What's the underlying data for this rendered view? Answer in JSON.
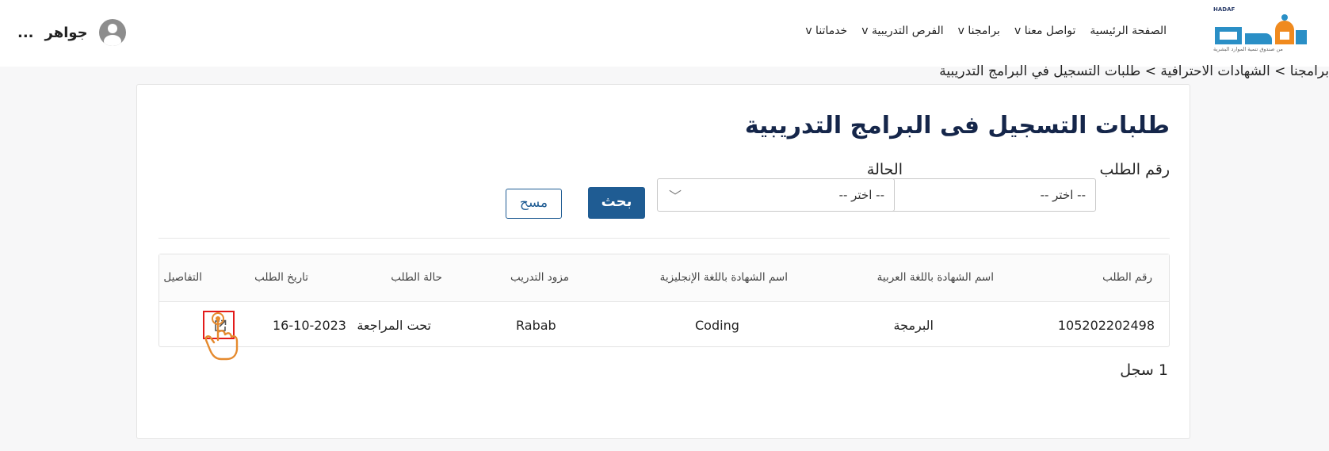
{
  "header": {
    "logo": {
      "brand_text": "HADAF",
      "tagline": "من صندوق تنمية الموارد البشرية"
    },
    "nav": [
      {
        "label": "الصفحة الرئيسية"
      },
      {
        "label": "تواصل معنا v"
      },
      {
        "label": "برامجنا v"
      },
      {
        "label": "الفرص التدريبية v"
      },
      {
        "label": "خدماتنا v"
      }
    ],
    "user": {
      "name": "جواهر",
      "more": "..."
    }
  },
  "breadcrumb": "برامجنا > الشهادات الاحترافية > طلبات التسجيل في البرامج التدريبية",
  "page": {
    "title": "طلبات التسجيل فى البرامج التدريبية",
    "filters": {
      "request_number": {
        "label": "رقم الطلب",
        "value": "-- اختر --"
      },
      "status": {
        "label": "الحالة",
        "value": "-- اختر --"
      }
    },
    "search_label": "بحث",
    "clear_label": "مسح"
  },
  "table": {
    "columns": {
      "request_number": "رقم الطلب",
      "cert_name_ar": "اسم الشهادة باللغة العربية",
      "cert_name_en": "اسم الشهادة باللغة الإنجليزية",
      "provider": "مزود التدريب",
      "status": "حالة الطلب",
      "date": "تاريخ الطلب",
      "details": "التفاصيل"
    },
    "rows": [
      {
        "request_number": "105202202498",
        "cert_name_ar": "البرمجة",
        "cert_name_en": "Coding",
        "provider": "Rabab",
        "status": "تحت المراجعة",
        "date": "16-10-2023"
      }
    ]
  },
  "record_count": "1 سجل",
  "colors": {
    "primary": "#1f5c93",
    "title": "#15264a",
    "highlight": "#e31b1b",
    "pointer": "#e58a2e",
    "logo_blue": "#2a8fc6",
    "logo_orange": "#f08a1e"
  }
}
